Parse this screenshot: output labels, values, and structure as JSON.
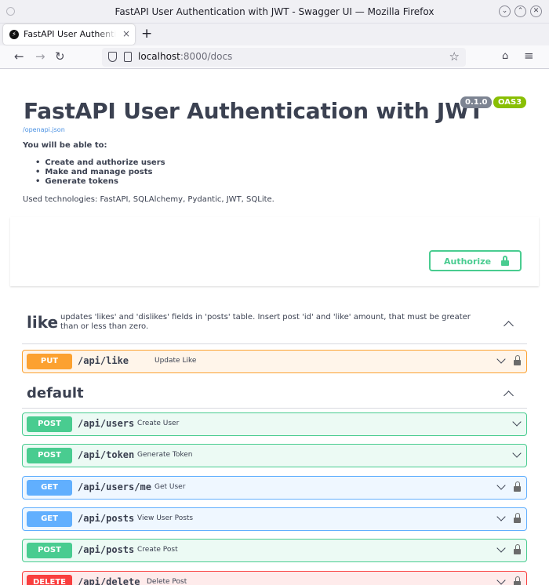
{
  "window": {
    "title": "FastAPI User Authentication with JWT - Swagger UI — Mozilla Firefox",
    "buttons": [
      "⌄",
      "⌃",
      "✕"
    ]
  },
  "tab": {
    "title": "FastAPI User Authentication with JWT - Swagger UI",
    "close": "×",
    "new_tab": "+"
  },
  "nav": {
    "back": "←",
    "forward": "→",
    "reload": "↻",
    "url_host": "localhost",
    "url_rest": ":8000/docs",
    "bookmark": "☆",
    "pocket": "⌂",
    "menu": "≡"
  },
  "api": {
    "title": "FastAPI User Authentication with JWT",
    "version": "0.1.0",
    "oas": "OAS3",
    "spec_link": "/openapi.json",
    "description_heading": "You will be able to:",
    "features": [
      "Create and authorize users",
      "Make and manage posts",
      "Generate tokens"
    ],
    "technologies": "Used technologies: FastAPI, SQLAlchemy, Pydantic, JWT, SQLite."
  },
  "authorize": {
    "label": "Authorize"
  },
  "tags": {
    "like": {
      "name": "like",
      "description": "updates 'likes' and 'dislikes' fields in 'posts' table. Insert post 'id' and 'like' amount, that must be greater than or less than zero."
    },
    "default": {
      "name": "default"
    }
  },
  "operations": [
    {
      "method": "PUT",
      "path": "/api/like",
      "summary": "Update Like",
      "locked": true
    },
    {
      "method": "POST",
      "path": "/api/users",
      "summary": "Create User",
      "locked": false
    },
    {
      "method": "POST",
      "path": "/api/token",
      "summary": "Generate Token",
      "locked": false
    },
    {
      "method": "GET",
      "path": "/api/users/me",
      "summary": "Get User",
      "locked": true
    },
    {
      "method": "GET",
      "path": "/api/posts",
      "summary": "View User Posts",
      "locked": true
    },
    {
      "method": "POST",
      "path": "/api/posts",
      "summary": "Create Post",
      "locked": true
    },
    {
      "method": "DELETE",
      "path": "/api/delete",
      "summary": "Delete Post",
      "locked": true
    }
  ],
  "colors": {
    "put": "#fca130",
    "post": "#49cc90",
    "get": "#61affe",
    "delete": "#f93e3e"
  }
}
